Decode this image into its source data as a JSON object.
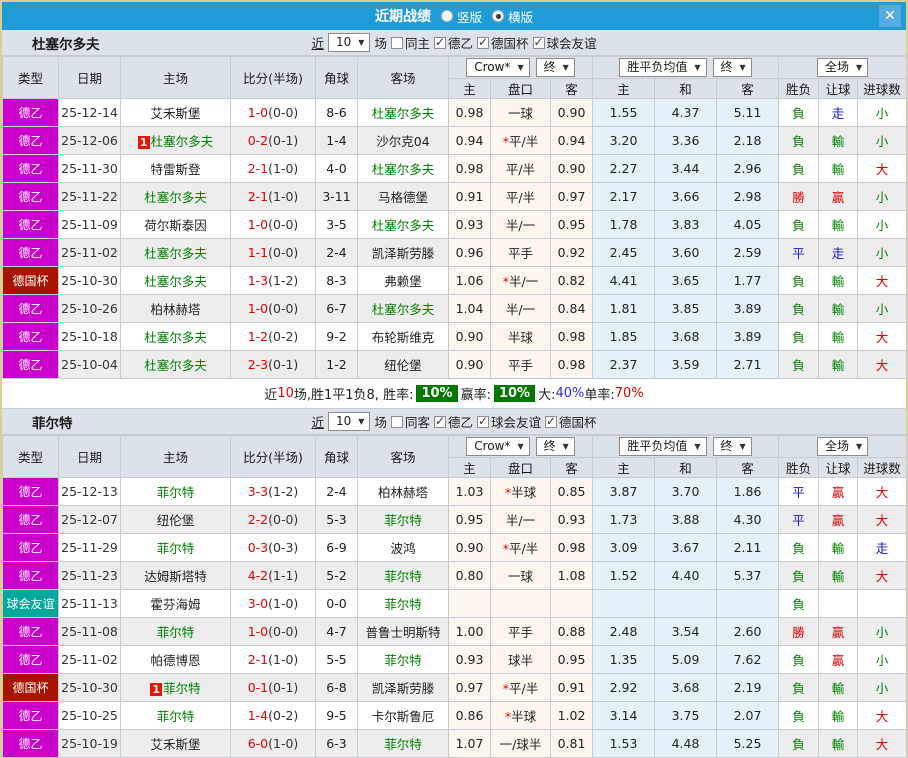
{
  "title_bar": {
    "title": "近期战绩",
    "options": [
      {
        "label": "竖版",
        "selected": false
      },
      {
        "label": "横版",
        "selected": true
      }
    ],
    "close": "✕"
  },
  "colors": {
    "accent_blue": "#1f9bd8",
    "league_magenta": "#cc00cc",
    "cup_dark_red": "#a81301",
    "friendly_teal": "#00a89e",
    "team_green": "#008000",
    "score_red": "#e60000",
    "result_red": "#dd0000",
    "result_green": "#008000",
    "result_blue": "#1616cc",
    "rate_box_green": "#007800"
  },
  "tables": [
    {
      "team": "杜塞尔多夫",
      "filter": {
        "near_label": "近",
        "count": "10",
        "games_label": "场",
        "same_label": "同主",
        "same_checked": false,
        "comps": [
          {
            "label": "德乙",
            "checked": true
          },
          {
            "label": "德国杯",
            "checked": true
          },
          {
            "label": "球会友谊",
            "checked": true
          }
        ]
      },
      "header": {
        "left": [
          "类型",
          "日期",
          "主场",
          "比分(半场)",
          "角球",
          "客场"
        ],
        "selects": [
          "Crow*",
          "终",
          "胜平负均值",
          "终",
          "全场"
        ],
        "sub": [
          "主",
          "盘口",
          "客",
          "主",
          "和",
          "客",
          "胜负",
          "让球",
          "进球数"
        ]
      },
      "rows": [
        {
          "type": "德乙",
          "tc": "league",
          "date": "25-12-14",
          "home": "艾禾斯堡",
          "hg": false,
          "hb": false,
          "score": "1-0",
          "half": "(0-0)",
          "corner": "8-6",
          "away": "杜塞尔多夫",
          "ag": true,
          "ab": false,
          "o1": "0.98",
          "hstar": false,
          "hcap": "一球",
          "o2": "0.90",
          "a1": "1.55",
          "a2": "4.37",
          "a3": "5.11",
          "r1": {
            "t": "負",
            "c": "g"
          },
          "r2": {
            "t": "走",
            "c": "b"
          },
          "r3": {
            "t": "小",
            "c": "g"
          }
        },
        {
          "type": "德乙",
          "tc": "league",
          "date": "25-12-06",
          "home": "杜塞尔多夫",
          "hg": true,
          "hb": true,
          "score": "0-2",
          "half": "(0-1)",
          "corner": "1-4",
          "away": "沙尔克04",
          "ag": false,
          "ab": false,
          "o1": "0.94",
          "hstar": true,
          "hcap": "平/半",
          "o2": "0.94",
          "a1": "3.20",
          "a2": "3.36",
          "a3": "2.18",
          "r1": {
            "t": "負",
            "c": "g"
          },
          "r2": {
            "t": "輸",
            "c": "g"
          },
          "r3": {
            "t": "小",
            "c": "g"
          }
        },
        {
          "type": "德乙",
          "tc": "league",
          "date": "25-11-30",
          "home": "特雷斯登",
          "hg": false,
          "hb": false,
          "score": "2-1",
          "half": "(1-0)",
          "corner": "4-0",
          "away": "杜塞尔多夫",
          "ag": true,
          "ab": false,
          "o1": "0.98",
          "hstar": false,
          "hcap": "平/半",
          "o2": "0.90",
          "a1": "2.27",
          "a2": "3.44",
          "a3": "2.96",
          "r1": {
            "t": "負",
            "c": "g"
          },
          "r2": {
            "t": "輸",
            "c": "g"
          },
          "r3": {
            "t": "大",
            "c": "r"
          }
        },
        {
          "type": "德乙",
          "tc": "league",
          "date": "25-11-22",
          "home": "杜塞尔多夫",
          "hg": true,
          "hb": false,
          "score": "2-1",
          "half": "(1-0)",
          "corner": "3-11",
          "away": "马格德堡",
          "ag": false,
          "ab": false,
          "o1": "0.91",
          "hstar": false,
          "hcap": "平/半",
          "o2": "0.97",
          "a1": "2.17",
          "a2": "3.66",
          "a3": "2.98",
          "r1": {
            "t": "勝",
            "c": "r"
          },
          "r2": {
            "t": "贏",
            "c": "r"
          },
          "r3": {
            "t": "小",
            "c": "g"
          }
        },
        {
          "type": "德乙",
          "tc": "league",
          "date": "25-11-09",
          "home": "荷尔斯泰因",
          "hg": false,
          "hb": false,
          "score": "1-0",
          "half": "(0-0)",
          "corner": "3-5",
          "away": "杜塞尔多夫",
          "ag": true,
          "ab": false,
          "o1": "0.93",
          "hstar": false,
          "hcap": "半/一",
          "o2": "0.95",
          "a1": "1.78",
          "a2": "3.83",
          "a3": "4.05",
          "r1": {
            "t": "負",
            "c": "g"
          },
          "r2": {
            "t": "輸",
            "c": "g"
          },
          "r3": {
            "t": "小",
            "c": "g"
          }
        },
        {
          "type": "德乙",
          "tc": "league",
          "date": "25-11-02",
          "home": "杜塞尔多夫",
          "hg": true,
          "hb": false,
          "score": "1-1",
          "half": "(0-0)",
          "corner": "2-4",
          "away": "凯泽斯劳滕",
          "ag": false,
          "ab": false,
          "o1": "0.96",
          "hstar": false,
          "hcap": "平手",
          "o2": "0.92",
          "a1": "2.45",
          "a2": "3.60",
          "a3": "2.59",
          "r1": {
            "t": "平",
            "c": "b"
          },
          "r2": {
            "t": "走",
            "c": "b"
          },
          "r3": {
            "t": "小",
            "c": "g"
          }
        },
        {
          "type": "德国杯",
          "tc": "cup",
          "date": "25-10-30",
          "home": "杜塞尔多夫",
          "hg": true,
          "hb": false,
          "score": "1-3",
          "half": "(1-2)",
          "corner": "8-3",
          "away": "弗赖堡",
          "ag": false,
          "ab": false,
          "o1": "1.06",
          "hstar": true,
          "hcap": "半/一",
          "o2": "0.82",
          "a1": "4.41",
          "a2": "3.65",
          "a3": "1.77",
          "r1": {
            "t": "負",
            "c": "g"
          },
          "r2": {
            "t": "輸",
            "c": "g"
          },
          "r3": {
            "t": "大",
            "c": "r"
          }
        },
        {
          "type": "德乙",
          "tc": "league",
          "date": "25-10-26",
          "home": "柏林赫塔",
          "hg": false,
          "hb": false,
          "score": "1-0",
          "half": "(0-0)",
          "corner": "6-7",
          "away": "杜塞尔多夫",
          "ag": true,
          "ab": false,
          "o1": "1.04",
          "hstar": false,
          "hcap": "半/一",
          "o2": "0.84",
          "a1": "1.81",
          "a2": "3.85",
          "a3": "3.89",
          "r1": {
            "t": "負",
            "c": "g"
          },
          "r2": {
            "t": "輸",
            "c": "g"
          },
          "r3": {
            "t": "小",
            "c": "g"
          }
        },
        {
          "type": "德乙",
          "tc": "league",
          "date": "25-10-18",
          "home": "杜塞尔多夫",
          "hg": true,
          "hb": false,
          "score": "1-2",
          "half": "(0-2)",
          "corner": "9-2",
          "away": "布轮斯维克",
          "ag": false,
          "ab": false,
          "o1": "0.90",
          "hstar": false,
          "hcap": "半球",
          "o2": "0.98",
          "a1": "1.85",
          "a2": "3.68",
          "a3": "3.89",
          "r1": {
            "t": "負",
            "c": "g"
          },
          "r2": {
            "t": "輸",
            "c": "g"
          },
          "r3": {
            "t": "大",
            "c": "r"
          }
        },
        {
          "type": "德乙",
          "tc": "league",
          "date": "25-10-04",
          "home": "杜塞尔多夫",
          "hg": true,
          "hb": false,
          "score": "2-3",
          "half": "(0-1)",
          "corner": "1-2",
          "away": "纽伦堡",
          "ag": false,
          "ab": false,
          "o1": "0.90",
          "hstar": false,
          "hcap": "平手",
          "o2": "0.98",
          "a1": "2.37",
          "a2": "3.59",
          "a3": "2.71",
          "r1": {
            "t": "負",
            "c": "g"
          },
          "r2": {
            "t": "輸",
            "c": "g"
          },
          "r3": {
            "t": "大",
            "c": "r"
          }
        }
      ],
      "summary": [
        {
          "t": "近",
          "s": "plain"
        },
        {
          "t": "10",
          "s": "red"
        },
        {
          "t": "场,胜1平1负8, 胜率:",
          "s": "plain"
        },
        {
          "t": "10%",
          "s": "box"
        },
        {
          "t": " 赢率:",
          "s": "plain"
        },
        {
          "t": "10%",
          "s": "box"
        },
        {
          "t": " 大:",
          "s": "plain"
        },
        {
          "t": "40%",
          "s": "blue"
        },
        {
          "t": " 单率:",
          "s": "plain"
        },
        {
          "t": "70%",
          "s": "red"
        }
      ]
    },
    {
      "team": "菲尔特",
      "filter": {
        "near_label": "近",
        "count": "10",
        "games_label": "场",
        "same_label": "同客",
        "same_checked": false,
        "comps": [
          {
            "label": "德乙",
            "checked": true
          },
          {
            "label": "球会友谊",
            "checked": true
          },
          {
            "label": "德国杯",
            "checked": true
          }
        ]
      },
      "header": {
        "left": [
          "类型",
          "日期",
          "主场",
          "比分(半场)",
          "角球",
          "客场"
        ],
        "selects": [
          "Crow*",
          "终",
          "胜平负均值",
          "终",
          "全场"
        ],
        "sub": [
          "主",
          "盘口",
          "客",
          "主",
          "和",
          "客",
          "胜负",
          "让球",
          "进球数"
        ]
      },
      "rows": [
        {
          "type": "德乙",
          "tc": "league",
          "date": "25-12-13",
          "home": "菲尔特",
          "hg": true,
          "hb": false,
          "score": "3-3",
          "half": "(1-2)",
          "corner": "2-4",
          "away": "柏林赫塔",
          "ag": false,
          "ab": false,
          "o1": "1.03",
          "hstar": true,
          "hcap": "半球",
          "o2": "0.85",
          "a1": "3.87",
          "a2": "3.70",
          "a3": "1.86",
          "r1": {
            "t": "平",
            "c": "b"
          },
          "r2": {
            "t": "贏",
            "c": "r"
          },
          "r3": {
            "t": "大",
            "c": "r"
          }
        },
        {
          "type": "德乙",
          "tc": "league",
          "date": "25-12-07",
          "home": "纽伦堡",
          "hg": false,
          "hb": false,
          "score": "2-2",
          "half": "(0-0)",
          "corner": "5-3",
          "away": "菲尔特",
          "ag": true,
          "ab": false,
          "o1": "0.95",
          "hstar": false,
          "hcap": "半/一",
          "o2": "0.93",
          "a1": "1.73",
          "a2": "3.88",
          "a3": "4.30",
          "r1": {
            "t": "平",
            "c": "b"
          },
          "r2": {
            "t": "贏",
            "c": "r"
          },
          "r3": {
            "t": "大",
            "c": "r"
          }
        },
        {
          "type": "德乙",
          "tc": "league",
          "date": "25-11-29",
          "home": "菲尔特",
          "hg": true,
          "hb": false,
          "score": "0-3",
          "half": "(0-3)",
          "corner": "6-9",
          "away": "波鸿",
          "ag": false,
          "ab": false,
          "o1": "0.90",
          "hstar": true,
          "hcap": "平/半",
          "o2": "0.98",
          "a1": "3.09",
          "a2": "3.67",
          "a3": "2.11",
          "r1": {
            "t": "負",
            "c": "g"
          },
          "r2": {
            "t": "輸",
            "c": "g"
          },
          "r3": {
            "t": "走",
            "c": "b"
          }
        },
        {
          "type": "德乙",
          "tc": "league",
          "date": "25-11-23",
          "home": "达姆斯塔特",
          "hg": false,
          "hb": false,
          "score": "4-2",
          "half": "(1-1)",
          "corner": "5-2",
          "away": "菲尔特",
          "ag": true,
          "ab": false,
          "o1": "0.80",
          "hstar": false,
          "hcap": "一球",
          "o2": "1.08",
          "a1": "1.52",
          "a2": "4.40",
          "a3": "5.37",
          "r1": {
            "t": "負",
            "c": "g"
          },
          "r2": {
            "t": "輸",
            "c": "g"
          },
          "r3": {
            "t": "大",
            "c": "r"
          }
        },
        {
          "type": "球会友谊",
          "tc": "friendly",
          "date": "25-11-13",
          "home": "霍芬海姆",
          "hg": false,
          "hb": false,
          "score": "3-0",
          "half": "(1-0)",
          "corner": "0-0",
          "away": "菲尔特",
          "ag": true,
          "ab": false,
          "o1": "",
          "hstar": false,
          "hcap": "",
          "o2": "",
          "a1": "",
          "a2": "",
          "a3": "",
          "r1": {
            "t": "負",
            "c": "g"
          },
          "r2": {
            "t": "",
            "c": "g"
          },
          "r3": {
            "t": "",
            "c": "g"
          }
        },
        {
          "type": "德乙",
          "tc": "league",
          "date": "25-11-08",
          "home": "菲尔特",
          "hg": true,
          "hb": false,
          "score": "1-0",
          "half": "(0-0)",
          "corner": "4-7",
          "away": "普鲁士明斯特",
          "ag": false,
          "ab": false,
          "o1": "1.00",
          "hstar": false,
          "hcap": "平手",
          "o2": "0.88",
          "a1": "2.48",
          "a2": "3.54",
          "a3": "2.60",
          "r1": {
            "t": "勝",
            "c": "r"
          },
          "r2": {
            "t": "贏",
            "c": "r"
          },
          "r3": {
            "t": "小",
            "c": "g"
          }
        },
        {
          "type": "德乙",
          "tc": "league",
          "date": "25-11-02",
          "home": "帕德博恩",
          "hg": false,
          "hb": false,
          "score": "2-1",
          "half": "(1-0)",
          "corner": "5-5",
          "away": "菲尔特",
          "ag": true,
          "ab": false,
          "o1": "0.93",
          "hstar": false,
          "hcap": "球半",
          "o2": "0.95",
          "a1": "1.35",
          "a2": "5.09",
          "a3": "7.62",
          "r1": {
            "t": "負",
            "c": "g"
          },
          "r2": {
            "t": "贏",
            "c": "r"
          },
          "r3": {
            "t": "小",
            "c": "g"
          }
        },
        {
          "type": "德国杯",
          "tc": "cup",
          "date": "25-10-30",
          "home": "菲尔特",
          "hg": true,
          "hb": true,
          "score": "0-1",
          "half": "(0-1)",
          "corner": "6-8",
          "away": "凯泽斯劳滕",
          "ag": false,
          "ab": false,
          "o1": "0.97",
          "hstar": true,
          "hcap": "平/半",
          "o2": "0.91",
          "a1": "2.92",
          "a2": "3.68",
          "a3": "2.19",
          "r1": {
            "t": "負",
            "c": "g"
          },
          "r2": {
            "t": "輸",
            "c": "g"
          },
          "r3": {
            "t": "小",
            "c": "g"
          }
        },
        {
          "type": "德乙",
          "tc": "league",
          "date": "25-10-25",
          "home": "菲尔特",
          "hg": true,
          "hb": false,
          "score": "1-4",
          "half": "(0-2)",
          "corner": "9-5",
          "away": "卡尔斯鲁厄",
          "ag": false,
          "ab": false,
          "o1": "0.86",
          "hstar": true,
          "hcap": "半球",
          "o2": "1.02",
          "a1": "3.14",
          "a2": "3.75",
          "a3": "2.07",
          "r1": {
            "t": "負",
            "c": "g"
          },
          "r2": {
            "t": "輸",
            "c": "g"
          },
          "r3": {
            "t": "大",
            "c": "r"
          }
        },
        {
          "type": "德乙",
          "tc": "league",
          "date": "25-10-19",
          "home": "艾禾斯堡",
          "hg": false,
          "hb": false,
          "score": "6-0",
          "half": "(1-0)",
          "corner": "6-3",
          "away": "菲尔特",
          "ag": true,
          "ab": false,
          "o1": "1.07",
          "hstar": false,
          "hcap": "一/球半",
          "o2": "0.81",
          "a1": "1.53",
          "a2": "4.48",
          "a3": "5.25",
          "r1": {
            "t": "負",
            "c": "g"
          },
          "r2": {
            "t": "輸",
            "c": "g"
          },
          "r3": {
            "t": "大",
            "c": "r"
          }
        }
      ],
      "summary": null
    }
  ]
}
